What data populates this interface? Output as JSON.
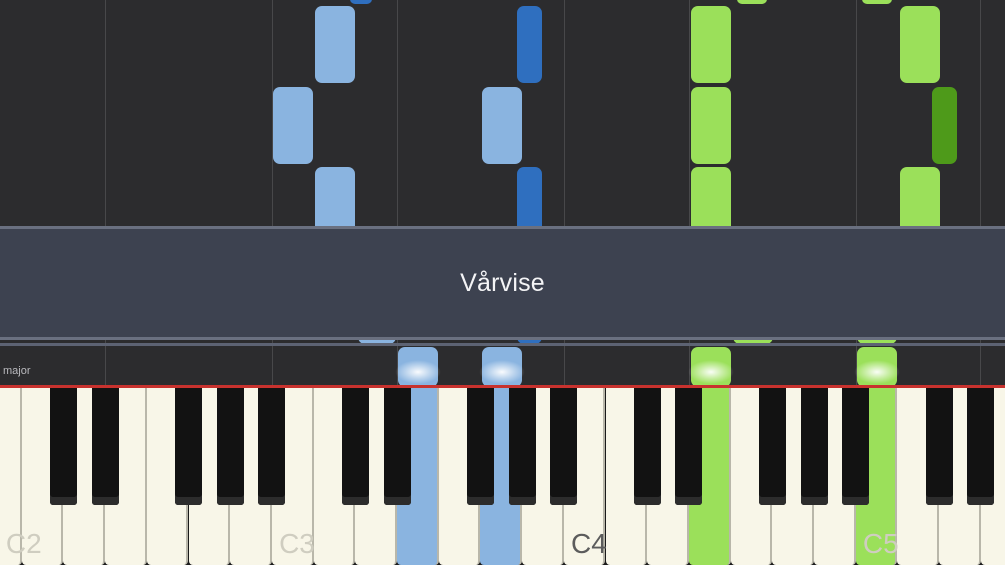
{
  "song": {
    "title": "Vårvise"
  },
  "key_signature": {
    "label": "major"
  },
  "keyboard": {
    "labels": {
      "c2": "C2",
      "c3": "C3",
      "c4": "C4",
      "c5": "C5"
    }
  },
  "colors": {
    "left_hand_light": "#8ab4e0",
    "left_hand_dark": "#2f6fbf",
    "right_hand_light": "#9be05a",
    "right_hand_dark": "#4e9a1a",
    "playhead": "#c8322e",
    "banner": "#3d4250"
  }
}
